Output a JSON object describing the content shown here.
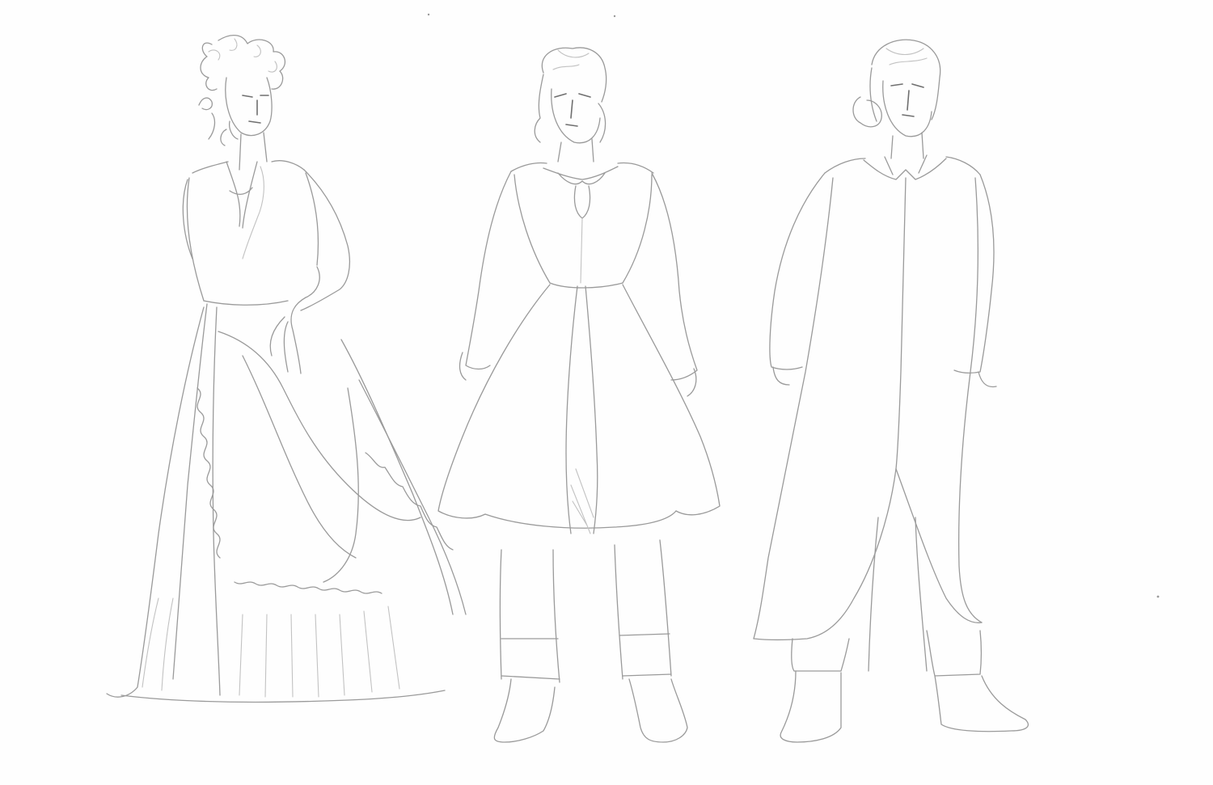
{
  "image": {
    "background_color": "#fefefe",
    "line_color": "#9a9a9a",
    "figures": [
      {
        "name": "figure-dress"
      },
      {
        "name": "figure-coat-breeches"
      },
      {
        "name": "figure-long-coat"
      }
    ]
  }
}
